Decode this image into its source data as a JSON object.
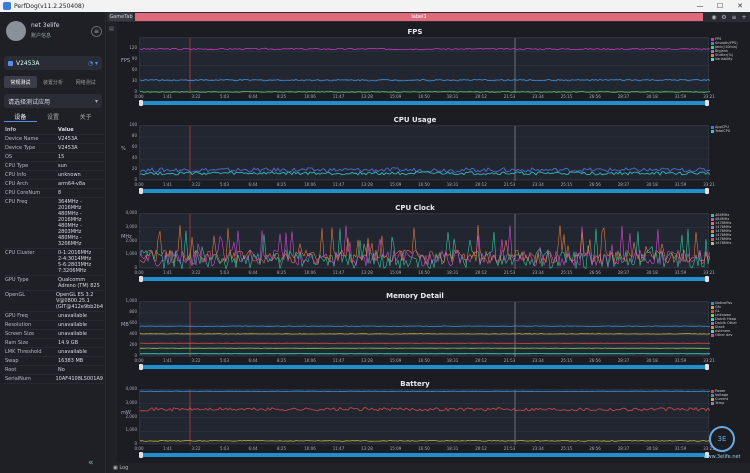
{
  "window": {
    "title": "PerfDog(v11.2.250408)",
    "controls": [
      "—",
      "☐",
      "✕"
    ]
  },
  "user": {
    "name": "net 3elife",
    "sub": "账户信息"
  },
  "device": {
    "name": "V2453A"
  },
  "mode_tabs": [
    {
      "label": "常规测试"
    },
    {
      "label": "装置分析"
    },
    {
      "label": "网络测试"
    }
  ],
  "app_select": {
    "placeholder": "请选择测试应用"
  },
  "sub_tabs": [
    {
      "label": "设备"
    },
    {
      "label": "设置"
    },
    {
      "label": "关于"
    }
  ],
  "info": [
    {
      "k": "Info",
      "v": "Value"
    },
    {
      "k": "Device Name",
      "v": "V2453A"
    },
    {
      "k": "Device Type",
      "v": "V2453A"
    },
    {
      "k": "OS",
      "v": "15"
    },
    {
      "k": "CPU Type",
      "v": "sun"
    },
    {
      "k": "CPU Info",
      "v": "unknown"
    },
    {
      "k": "CPU Arch",
      "v": "arm64-v8a"
    },
    {
      "k": "CPU CoreNum",
      "v": "8"
    },
    {
      "k": "CPU Freq",
      "v": "364MHz - 2016MHz\n480MHz - 2016MHz\n480MHz - 2803MHz\n480MHz - 3206MHz"
    },
    {
      "k": "CPU Cluster",
      "v": "0-1:2016MHz\n2-4:3014MHz\n5-6:2803MHz\n7:3206MHz"
    },
    {
      "k": "GPU Type",
      "v": "Qualcomm Adreno (TM) 825"
    },
    {
      "k": "OpenGL",
      "v": "OpenGL ES 3.2 V@0800.25.1 (GIT@412e9bb2b4"
    },
    {
      "k": "GPU Freq",
      "v": "unavailable"
    },
    {
      "k": "Resolution",
      "v": "unavailable"
    },
    {
      "k": "Screen Size",
      "v": "unavailable"
    },
    {
      "k": "Ram Size",
      "v": "14.9 GB"
    },
    {
      "k": "LMK Threshold",
      "v": "unavailable"
    },
    {
      "k": "Swap",
      "v": "16383 MB"
    },
    {
      "k": "Root",
      "v": "No"
    },
    {
      "k": "SerialNum",
      "v": "10AF4108LS001A9"
    }
  ],
  "topbar": {
    "game_tab": "GameTab",
    "label": "label1"
  },
  "bottombar": {
    "log": "Log"
  },
  "watermark": {
    "text": "www.3elife.net"
  },
  "time_ticks": [
    "0:00",
    "1:41",
    "3:22",
    "5:03",
    "6:44",
    "8:25",
    "10:06",
    "11:47",
    "13:28",
    "15:09",
    "16:50",
    "18:31",
    "20:12",
    "21:53",
    "23:34",
    "25:15",
    "26:56",
    "28:37",
    "30:18",
    "31:59",
    "33:21"
  ],
  "charts": [
    {
      "name": "fps",
      "title": "FPS",
      "unit": "FPS",
      "yticks": [
        "0",
        "30",
        "60",
        "90",
        "120"
      ],
      "ymax": 150,
      "series": [
        {
          "name": "FPS",
          "color": "#c23cc2",
          "level": 120,
          "noise": 2
        },
        {
          "name": "Smooth",
          "color": "#3b8fd9",
          "level": 35,
          "noise": 2
        },
        {
          "name": "Jank",
          "color": "#4fcf6b",
          "level": 3,
          "noise": 1
        }
      ],
      "legend": [
        "FPS",
        "Smooth(FPS)",
        "Jank(/10min)",
        "BigJank",
        "Stutter(%)",
        "Variability"
      ]
    },
    {
      "name": "cpu-usage",
      "title": "CPU Usage",
      "unit": "%",
      "yticks": [
        "0",
        "20",
        "40",
        "60",
        "80",
        "100"
      ],
      "ymax": 100,
      "series": [
        {
          "name": "AppCPU",
          "color": "#4e73df",
          "level": 20,
          "noise": 4
        },
        {
          "name": "TotalCPU",
          "color": "#31c7c7",
          "level": 14,
          "noise": 3
        }
      ],
      "legend": [
        "AppCPU",
        "TotalCPU"
      ]
    },
    {
      "name": "cpu-clock",
      "title": "CPU Clock",
      "unit": "MHz",
      "yticks": [
        "0",
        "1,000",
        "2,000",
        "3,000",
        "4,000"
      ],
      "ymax": 4000,
      "series": [
        {
          "name": "CPU0",
          "color": "#31c7a0",
          "level": 700,
          "noise": 700
        },
        {
          "name": "CPU2",
          "color": "#d44bd4",
          "level": 800,
          "noise": 600
        },
        {
          "name": "CPU5",
          "color": "#e07b3c",
          "level": 900,
          "noise": 500
        }
      ],
      "legend": [
        "484MHz",
        "484MHz",
        "1478MHz",
        "1478MHz",
        "1478MHz",
        "1478MHz",
        "1478MHz",
        "1478MHz"
      ]
    },
    {
      "name": "memory-detail",
      "title": "Memory Detail",
      "unit": "MB",
      "yticks": [
        "0",
        "200",
        "400",
        "600",
        "800",
        "1,000"
      ],
      "ymax": 1000,
      "series": [
        {
          "name": "Memory",
          "color": "#3b8fd9",
          "level": 560,
          "noise": 5
        },
        {
          "name": "NativePss",
          "color": "#c9b23a",
          "level": 420,
          "noise": 4
        },
        {
          "name": "Gfx",
          "color": "#d44b4b",
          "level": 250,
          "noise": 3
        },
        {
          "name": "GL",
          "color": "#7bd44b",
          "level": 160,
          "noise": 3
        },
        {
          "name": "Unknown",
          "color": "#3ad4c0",
          "level": 60,
          "noise": 2
        }
      ],
      "legend": [
        "NativePss",
        "Gfx",
        "GL",
        "Unknown",
        "Dalvik Heap",
        "Dalvik Other",
        "Stack",
        "Ashmem",
        "Other dev"
      ]
    },
    {
      "name": "battery",
      "title": "Battery",
      "unit": "mW",
      "yticks": [
        "0",
        "1,000",
        "2,000",
        "3,000",
        "4,000"
      ],
      "ymax": 4000,
      "series": [
        {
          "name": "Power",
          "color": "#d44b4b",
          "level": 2600,
          "noise": 120
        },
        {
          "name": "Voltage",
          "color": "#3b8fd9",
          "level": 3900,
          "noise": 20
        },
        {
          "name": "Current",
          "color": "#c9b23a",
          "level": 300,
          "noise": 30
        }
      ],
      "legend": [
        "Power",
        "Voltage",
        "Current",
        "Temp"
      ]
    }
  ]
}
